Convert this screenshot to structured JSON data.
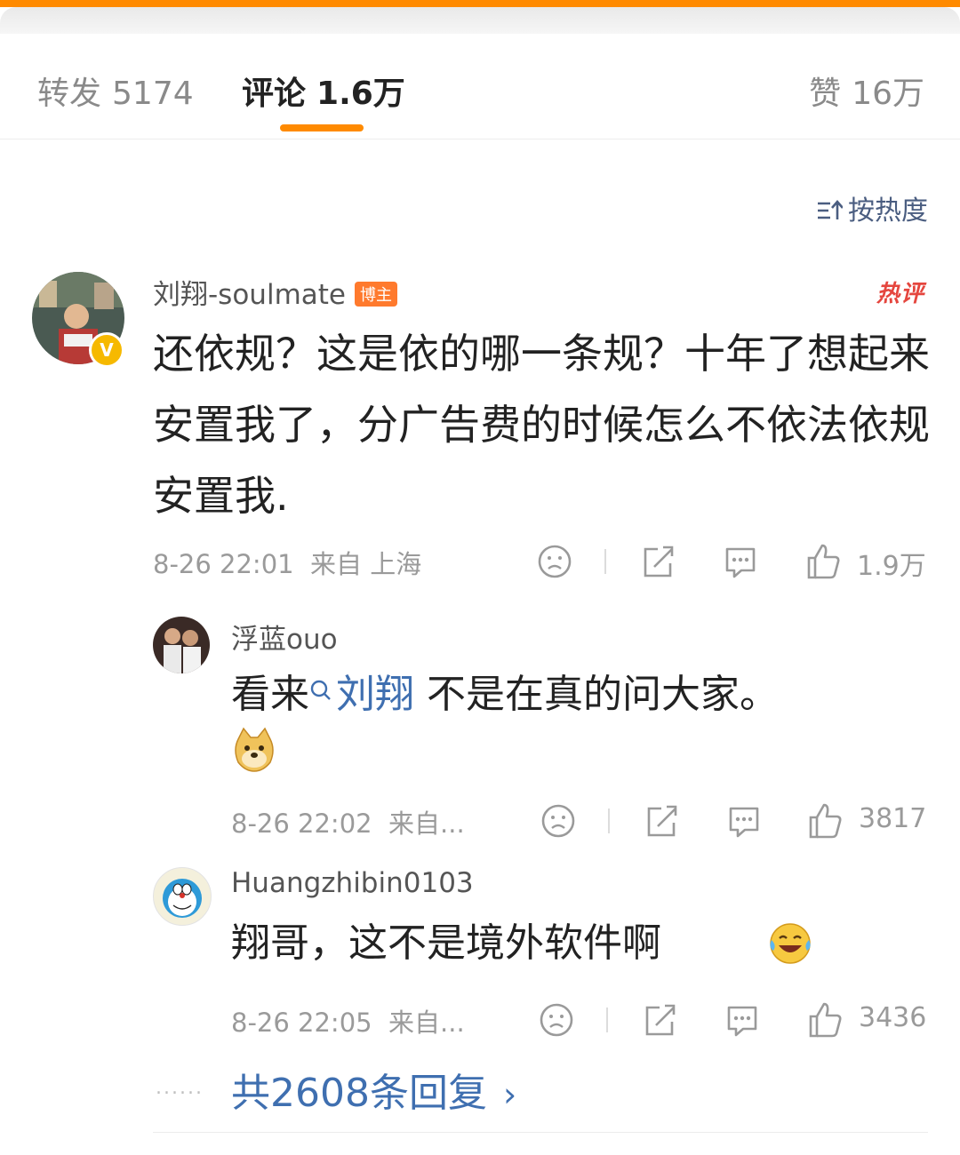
{
  "tabs": {
    "repost": {
      "label": "转发",
      "count": "5174"
    },
    "comments": {
      "label": "评论",
      "count": "1.6万"
    },
    "likes": {
      "label": "赞",
      "count": "16万"
    }
  },
  "sort": {
    "label": "按热度"
  },
  "main_comment": {
    "username": "刘翔-soulmate",
    "badge": "博主",
    "hot_tag": "热评",
    "text": "还依规？这是依的哪一条规？十年了想起来安置我了，分广告费的时候怎么不依法依规安置我.",
    "time": "8-26 22:01",
    "location": "来自 上海",
    "likes": "1.9万"
  },
  "replies": [
    {
      "username": "浮蓝ouo",
      "text_before": "看来",
      "mention": "刘翔",
      "text_after": " 不是在真的问大家。",
      "time": "8-26 22:02",
      "location": "来自...",
      "likes": "3817"
    },
    {
      "username": "Huangzhibin0103",
      "text": "翔哥，这不是境外软件啊",
      "time": "8-26 22:05",
      "location": "来自...",
      "likes": "3436"
    }
  ],
  "more": {
    "label": "共2608条回复",
    "dots": "......"
  },
  "colors": {
    "accent": "#ff8a00",
    "link": "#3f6fb0",
    "hot": "#e5463e",
    "host_badge": "#ff7a2d"
  }
}
